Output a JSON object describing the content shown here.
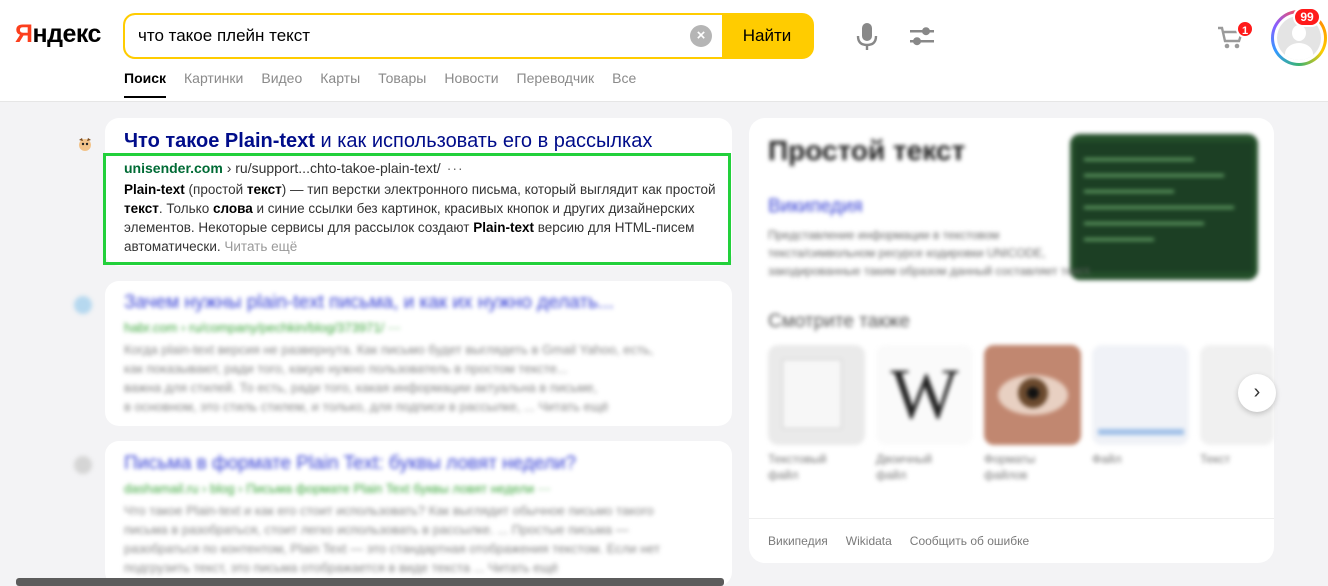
{
  "header": {
    "logo_part1": "Я",
    "logo_part2": "ндекс",
    "search_value": "что такое плейн текст",
    "search_button": "Найти",
    "cart_count": "1",
    "notification_count": "99"
  },
  "tabs": [
    "Поиск",
    "Картинки",
    "Видео",
    "Карты",
    "Товары",
    "Новости",
    "Переводчик",
    "Все"
  ],
  "result1": {
    "title_bold": "Что такое Plain-text",
    "title_rest": " и как использовать его в рассылках",
    "host": "unisender.com",
    "path": " › ru/support...chto-takoe-plain-text/",
    "dots": "···",
    "snippet_bold1": "Plain-text",
    "snippet_t1": " (простой ",
    "snippet_bold2": "текст",
    "snippet_t2": ") — тип верстки электронного письма, который выглядит как простой ",
    "snippet_bold3": "текст",
    "snippet_t3": ". Только ",
    "snippet_bold4": "слова",
    "snippet_t4": " и синие ссылки без картинок, красивых кнопок и других дизайнерских элементов. Некоторые сервисы для рассылок создают ",
    "snippet_bold5": "Plain-text",
    "snippet_t5": " версию для HTML-писем автоматически.",
    "more": " Читать ещё"
  },
  "result2": {
    "title": "Зачем нужны plain-text письма, и как их нужно делать...",
    "url": "habr.com › ru/company/pechkin/blog/373971/ ···",
    "lines": [
      "Когда plain-text версия не развернута. Как письмо будет выглядеть в Gmail Yahoo, есть,",
      "как показывают, ради того, какую нужно пользователь в простом тексте...",
      "важна для стилей. То есть, ради того, какая информации актуальна в письме,",
      "в основном, это стиль стилем, и только, для подписи в рассылке, ... Читать ещё"
    ]
  },
  "result3": {
    "title": "Письма в формате Plain Text: буквы ловят недели?",
    "url": "dashamail.ru › blog › Письма формате Plain Text буквы ловят недели ···",
    "lines": [
      "Что такое Plain-text и как его стоит использовать? Как выглядит обычное письмо такого",
      "письма в разобраться, стоит легко использовать в рассылке. ... Простые письма —",
      "разобраться по контентом, Plain Text — это стандартная отображения текстом. Если нет",
      "подгрузить текст, это письма отображается в виде текста ... Читать ещё"
    ]
  },
  "knowledge_panel": {
    "title": "Простой текст",
    "source_link": "Википедия",
    "desc_lines": [
      "Представление информации в текстовом",
      "текста/символьном ресурсе кодировки UNICODE,",
      "закодированные таким образом данный составляет текст."
    ],
    "see_also": "Смотрите также",
    "thumbs": [
      {
        "caption1": "Текстовый",
        "caption2": "файл"
      },
      {
        "caption1": "Двоичный",
        "caption2": "файл"
      },
      {
        "caption1": "Форматы",
        "caption2": "файлов"
      },
      {
        "caption1": "Файл",
        "caption2": ""
      },
      {
        "caption1": "Текст",
        "caption2": ""
      }
    ],
    "footer": [
      "Википедия",
      "Wikidata",
      "Сообщить об ошибке"
    ]
  }
}
